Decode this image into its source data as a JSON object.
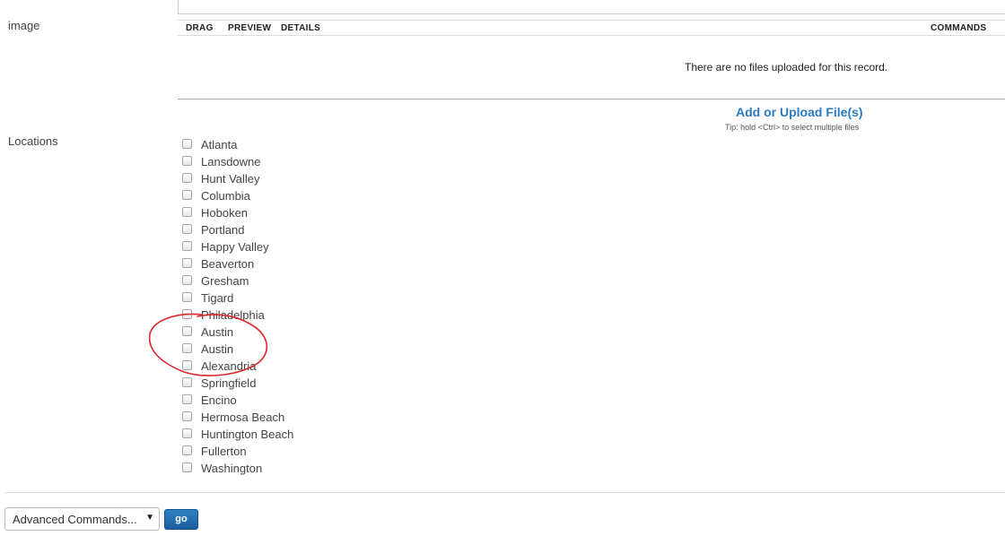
{
  "labels": {
    "image": "image",
    "locations": "Locations"
  },
  "files_table": {
    "columns": {
      "drag": "DRAG",
      "preview": "PREVIEW",
      "details": "DETAILS",
      "commands": "COMMANDS"
    },
    "empty_message": "There are no files uploaded for this record.",
    "upload_link": "Add or Upload File(s)",
    "upload_tip": "Tip: hold <Ctrl> to select multiple files"
  },
  "locations": [
    "Atlanta",
    "Lansdowne",
    "Hunt Valley",
    "Columbia",
    "Hoboken",
    "Portland",
    "Happy Valley",
    "Beaverton",
    "Gresham",
    "Tigard",
    "Philadelphia",
    "Austin",
    "Austin",
    "Alexandria",
    "Springfield",
    "Encino",
    "Hermosa Beach",
    "Huntington Beach",
    "Fullerton",
    "Washington"
  ],
  "footer": {
    "advanced_select": "Advanced Commands...",
    "go_button": "go"
  },
  "colors": {
    "link": "#2a7bbf",
    "annotation": "#d9262a",
    "go_button": "#1b5e9e"
  }
}
